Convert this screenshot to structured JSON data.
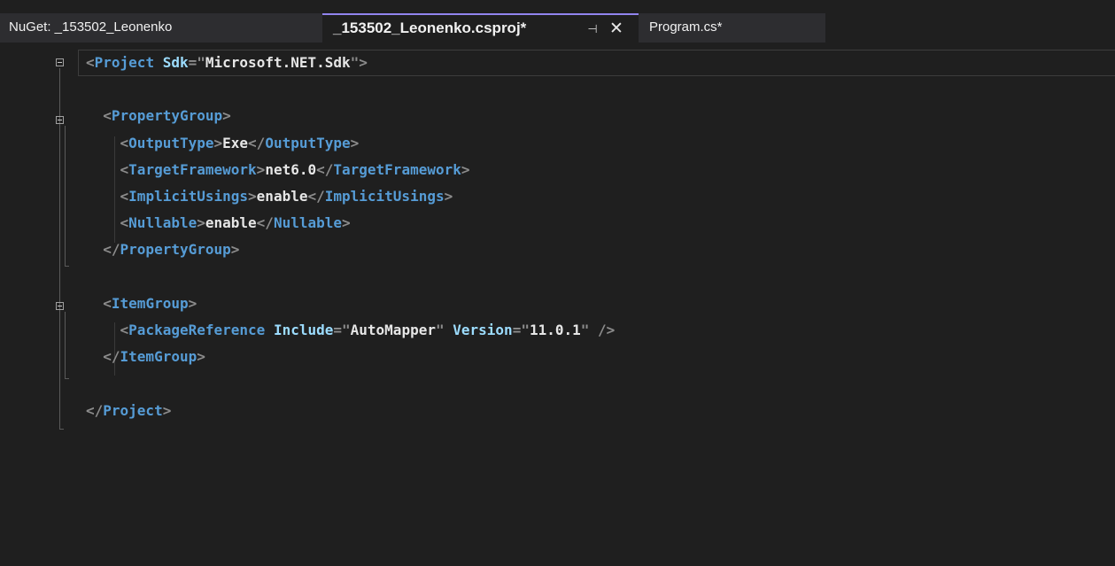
{
  "tabs": [
    {
      "label": "NuGet: _153502_Leonenko",
      "active": false
    },
    {
      "label": "_153502_Leonenko.csproj*",
      "active": true
    },
    {
      "label": "Program.cs*",
      "active": false
    }
  ],
  "active_tab": {
    "pin_icon": "⊣",
    "close_icon": "✕"
  },
  "editor": {
    "lines": [
      {
        "indent": "",
        "parts": [
          [
            "bracket",
            "<"
          ],
          [
            "tag",
            "Project"
          ],
          [
            "text",
            " "
          ],
          [
            "attr",
            "Sdk"
          ],
          [
            "bracket",
            "=\""
          ],
          [
            "text",
            "Microsoft.NET.Sdk"
          ],
          [
            "bracket",
            "\">"
          ]
        ]
      },
      {
        "indent": "",
        "parts": []
      },
      {
        "indent": "  ",
        "parts": [
          [
            "bracket",
            "<"
          ],
          [
            "tag",
            "PropertyGroup"
          ],
          [
            "bracket",
            ">"
          ]
        ]
      },
      {
        "indent": "    ",
        "parts": [
          [
            "bracket",
            "<"
          ],
          [
            "tag",
            "OutputType"
          ],
          [
            "bracket",
            ">"
          ],
          [
            "text",
            "Exe"
          ],
          [
            "bracket",
            "</"
          ],
          [
            "tag",
            "OutputType"
          ],
          [
            "bracket",
            ">"
          ]
        ]
      },
      {
        "indent": "    ",
        "parts": [
          [
            "bracket",
            "<"
          ],
          [
            "tag",
            "TargetFramework"
          ],
          [
            "bracket",
            ">"
          ],
          [
            "text",
            "net6.0"
          ],
          [
            "bracket",
            "</"
          ],
          [
            "tag",
            "TargetFramework"
          ],
          [
            "bracket",
            ">"
          ]
        ]
      },
      {
        "indent": "    ",
        "parts": [
          [
            "bracket",
            "<"
          ],
          [
            "tag",
            "ImplicitUsings"
          ],
          [
            "bracket",
            ">"
          ],
          [
            "text",
            "enable"
          ],
          [
            "bracket",
            "</"
          ],
          [
            "tag",
            "ImplicitUsings"
          ],
          [
            "bracket",
            ">"
          ]
        ]
      },
      {
        "indent": "    ",
        "parts": [
          [
            "bracket",
            "<"
          ],
          [
            "tag",
            "Nullable"
          ],
          [
            "bracket",
            ">"
          ],
          [
            "text",
            "enable"
          ],
          [
            "bracket",
            "</"
          ],
          [
            "tag",
            "Nullable"
          ],
          [
            "bracket",
            ">"
          ]
        ]
      },
      {
        "indent": "  ",
        "parts": [
          [
            "bracket",
            "</"
          ],
          [
            "tag",
            "PropertyGroup"
          ],
          [
            "bracket",
            ">"
          ]
        ]
      },
      {
        "indent": "",
        "parts": []
      },
      {
        "indent": "  ",
        "parts": [
          [
            "bracket",
            "<"
          ],
          [
            "tag",
            "ItemGroup"
          ],
          [
            "bracket",
            ">"
          ]
        ]
      },
      {
        "indent": "    ",
        "parts": [
          [
            "bracket",
            "<"
          ],
          [
            "tag",
            "PackageReference"
          ],
          [
            "text",
            " "
          ],
          [
            "attr",
            "Include"
          ],
          [
            "bracket",
            "=\""
          ],
          [
            "text",
            "AutoMapper"
          ],
          [
            "bracket",
            "\""
          ],
          [
            "text",
            " "
          ],
          [
            "attr",
            "Version"
          ],
          [
            "bracket",
            "=\""
          ],
          [
            "text",
            "11.0.1"
          ],
          [
            "bracket",
            "\""
          ],
          [
            "text",
            " "
          ],
          [
            "bracket",
            "/>"
          ]
        ]
      },
      {
        "indent": "  ",
        "parts": [
          [
            "bracket",
            "</"
          ],
          [
            "tag",
            "ItemGroup"
          ],
          [
            "bracket",
            ">"
          ]
        ]
      },
      {
        "indent": "",
        "parts": []
      },
      {
        "indent": "",
        "parts": [
          [
            "bracket",
            "</"
          ],
          [
            "tag",
            "Project"
          ],
          [
            "bracket",
            ">"
          ]
        ]
      }
    ]
  },
  "colors": {
    "tag": "#569cd6",
    "attribute": "#9cdcfe",
    "text": "#e6e6e6",
    "punctuation": "#8c8c8c",
    "active_tab_accent": "#9184ee",
    "background": "#1f1f1f"
  }
}
